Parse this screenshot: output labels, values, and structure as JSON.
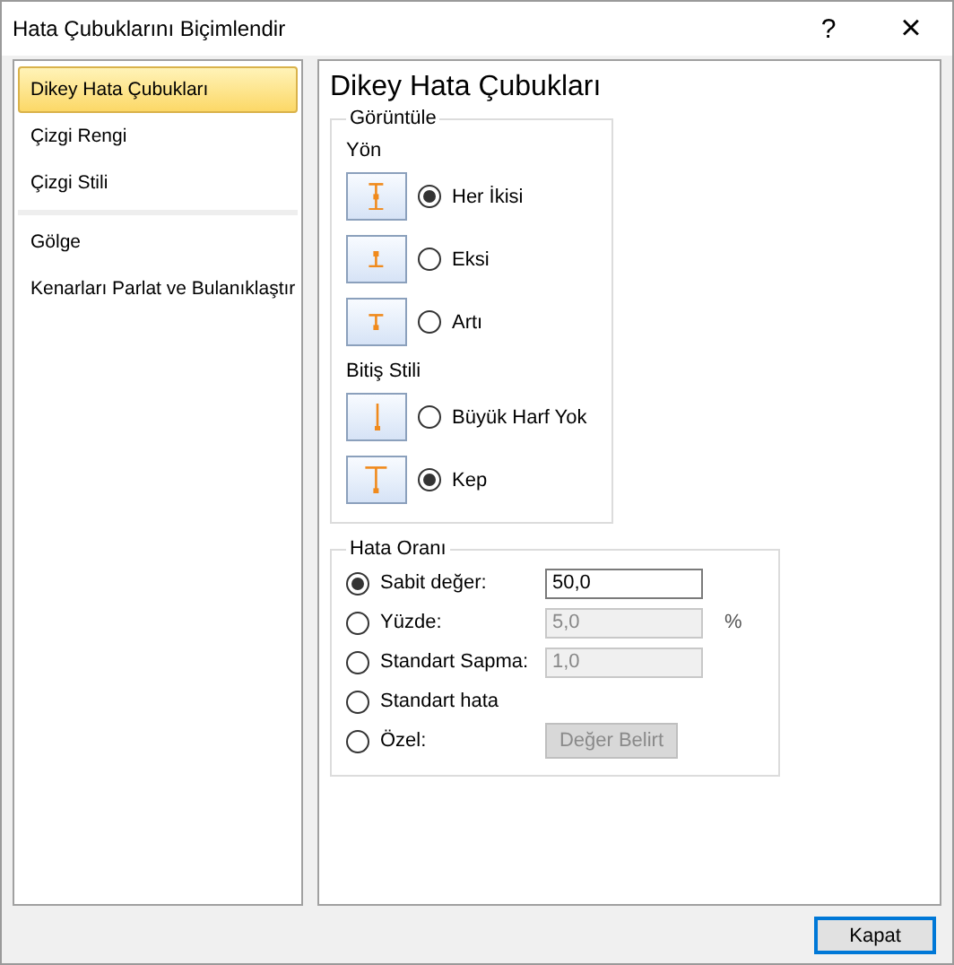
{
  "window": {
    "title": "Hata Çubuklarını Biçimlendir",
    "help": "?",
    "close": "×"
  },
  "sidebar": {
    "groups": [
      {
        "items": [
          {
            "label": "Dikey Hata Çubukları",
            "selected": true
          },
          {
            "label": "Çizgi Rengi",
            "selected": false
          },
          {
            "label": "Çizgi Stili",
            "selected": false
          }
        ]
      },
      {
        "items": [
          {
            "label": "Gölge",
            "selected": false
          },
          {
            "label": "Kenarları Parlat ve Bulanıklaştır",
            "selected": false
          }
        ]
      }
    ]
  },
  "panel": {
    "heading": "Dikey Hata Çubukları",
    "display": {
      "title": "Görüntüle",
      "sections": [
        {
          "label": "Yön",
          "options": [
            {
              "kind": "both",
              "label": "Her İkisi",
              "selected": true
            },
            {
              "kind": "minus",
              "label": "Eksi",
              "selected": false
            },
            {
              "kind": "plus",
              "label": "Artı",
              "selected": false
            }
          ]
        },
        {
          "label": "Bitiş Stili",
          "options": [
            {
              "kind": "nocap",
              "label": "Büyük Harf Yok",
              "selected": false
            },
            {
              "kind": "cap",
              "label": "Kep",
              "selected": true
            }
          ]
        }
      ]
    },
    "error_amount": {
      "title": "Hata Oranı",
      "rows": [
        {
          "kind": "field",
          "label": "Sabit değer:",
          "selected": true,
          "value": "50,0",
          "disabled": false
        },
        {
          "kind": "field",
          "label": "Yüzde:",
          "selected": false,
          "value": "5,0",
          "disabled": true,
          "unit": "%"
        },
        {
          "kind": "field",
          "label": "Standart Sapma:",
          "selected": false,
          "value": "1,0",
          "disabled": true
        },
        {
          "kind": "plain",
          "label": "Standart hata",
          "selected": false
        },
        {
          "kind": "button",
          "label": "Özel:",
          "selected": false,
          "button": "Değer Belirt",
          "disabled": true
        }
      ]
    }
  },
  "buttons": [
    {
      "label": "Kapat",
      "default": true
    }
  ]
}
